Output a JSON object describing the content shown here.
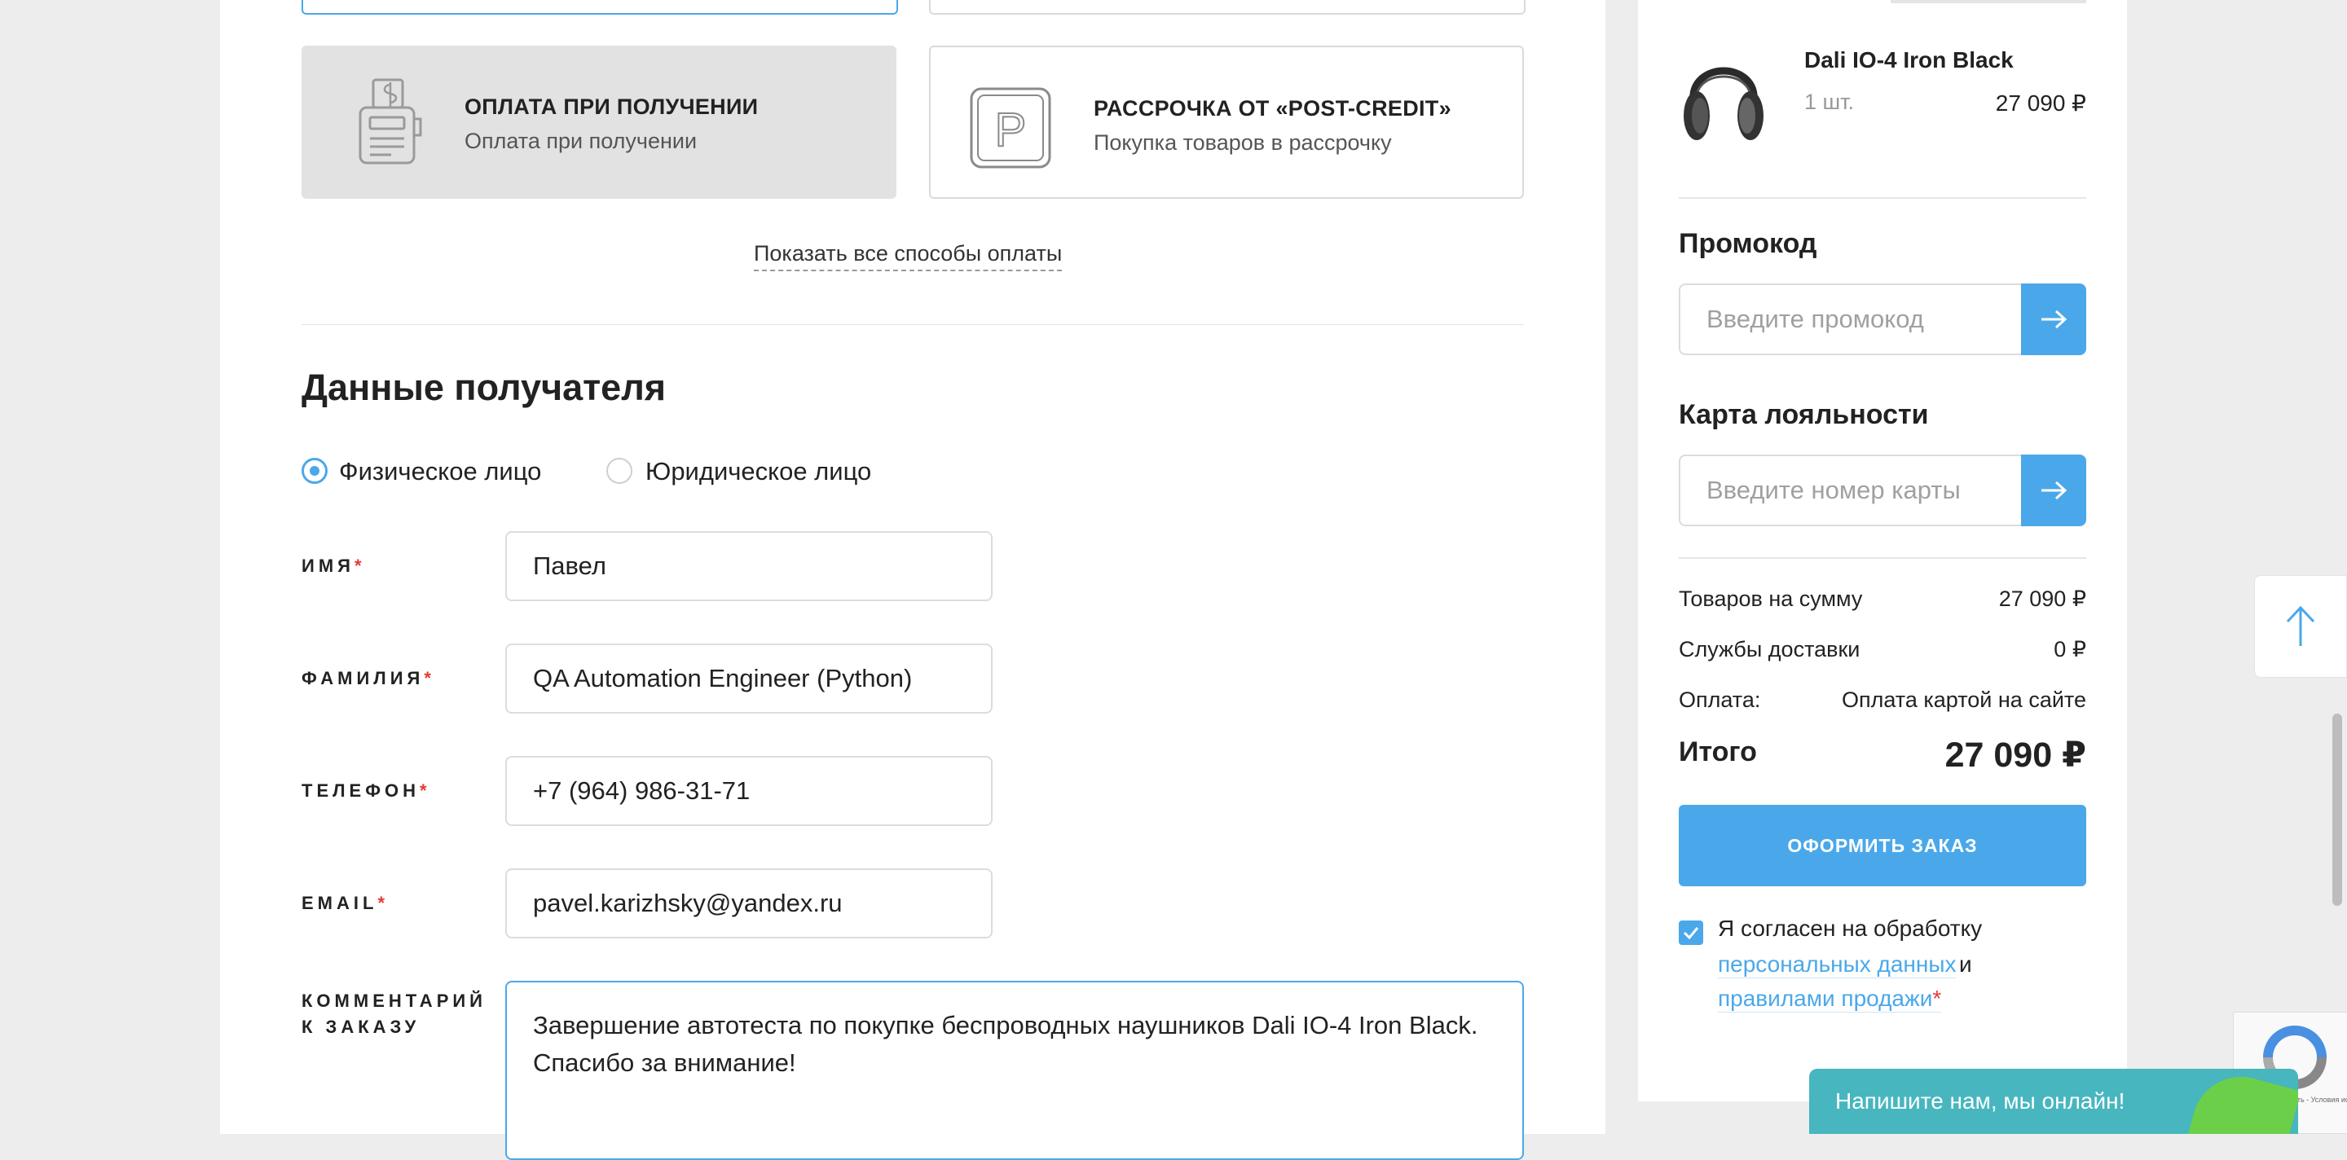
{
  "payment": {
    "cod": {
      "title": "ОПЛАТА ПРИ ПОЛУЧЕНИИ",
      "subtitle": "Оплата при получении",
      "icon": "cash-register-icon"
    },
    "credit": {
      "title": "РАССРОЧКА ОТ «POST-CREDIT»",
      "subtitle": "Покупка товаров в рассрочку",
      "icon": "post-credit-logo-icon",
      "icon_letter": "P"
    },
    "show_all": "Показать все способы оплаты"
  },
  "recipient": {
    "title": "Данные получателя",
    "types": {
      "individual": "Физическое лицо",
      "legal": "Юридическое лицо",
      "selected": "individual"
    },
    "fields": {
      "name": {
        "label": "ИМЯ",
        "required": "*",
        "value": "Павел"
      },
      "surname": {
        "label": "ФАМИЛИЯ",
        "required": "*",
        "value": "QA Automation Engineer (Python)"
      },
      "phone": {
        "label": "ТЕЛЕФОН",
        "required": "*",
        "value": "+7 (964) 986-31-71"
      },
      "email": {
        "label": "EMAIL",
        "required": "*",
        "value": "pavel.karizhsky@yandex.ru"
      },
      "comment": {
        "label_line1": "КОММЕНТАРИЙ",
        "label_line2": "К ЗАКАЗУ",
        "value": "Завершение автотеста по покупке беспроводных наушников Dali IO-4 Iron Black. Спасибо за внимание!"
      }
    }
  },
  "cart": {
    "product": {
      "name": "Dali IO-4 Iron Black",
      "qty": "1 шт.",
      "price": "27 090 ₽"
    },
    "promo": {
      "title": "Промокод",
      "placeholder": "Введите промокод"
    },
    "loyalty": {
      "title": "Карта лояльности",
      "placeholder": "Введите номер карты"
    },
    "summary": {
      "goods_label": "Товаров на сумму",
      "goods_value": "27 090 ₽",
      "delivery_label": "Службы доставки",
      "delivery_value": "0 ₽",
      "payment_label": "Оплата:",
      "payment_value": "Оплата картой на сайте",
      "total_label": "Итого",
      "total_value": "27 090 ₽"
    },
    "order_button": "ОФОРМИТЬ ЗАКАЗ",
    "agreement": {
      "checked": true,
      "text": "Я согласен на обработку",
      "link1": "персональных данных",
      "and": "и",
      "link2": "правилами продажи",
      "required": "*"
    }
  },
  "widgets": {
    "chat": "Напишите нам, мы онлайн!",
    "recaptcha_text": "иденциальность - Условия использования"
  },
  "colors": {
    "accent": "#4aa8ea",
    "required": "#e53935",
    "chat": "#47b6bf"
  }
}
